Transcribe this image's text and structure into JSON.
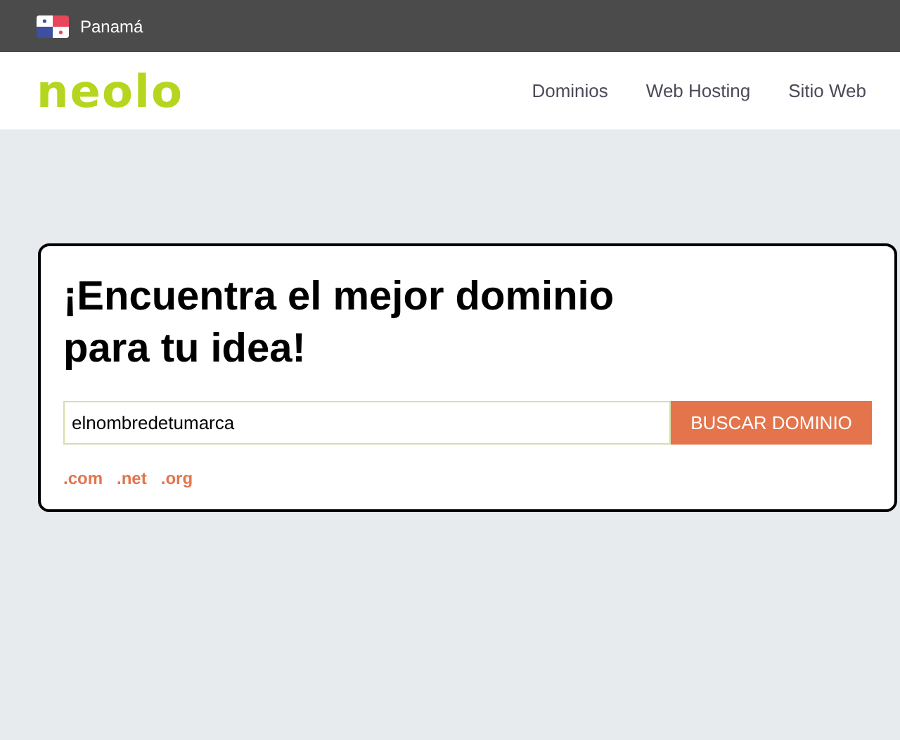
{
  "top_bar": {
    "country": "Panamá"
  },
  "header": {
    "logo": "neolo",
    "nav": [
      "Dominios",
      "Web Hosting",
      "Sitio Web"
    ]
  },
  "search_card": {
    "title": "¡Encuentra el mejor dominio para tu idea!",
    "input_value": "elnombredetumarca",
    "button": "BUSCAR DOMINIO",
    "extensions": [
      ".com",
      ".net",
      ".org"
    ]
  }
}
